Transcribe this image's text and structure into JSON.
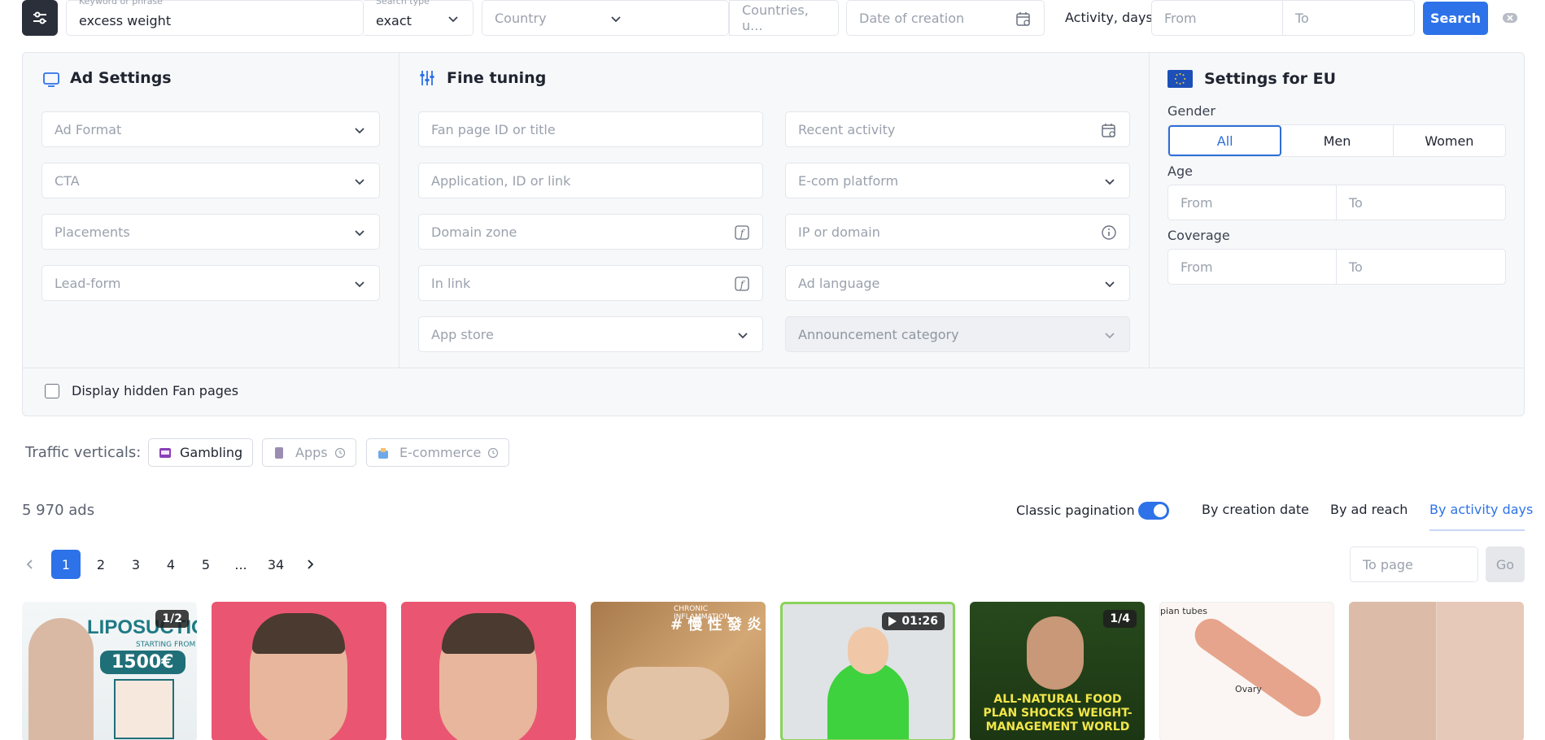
{
  "topbar": {
    "keyword_label": "Keyword or phrase",
    "keyword_value": "excess weight",
    "search_type_label": "Search type",
    "search_type_value": "exact",
    "country_placeholder": "Country",
    "countries_placeholder": "Countries, u...",
    "date_placeholder": "Date of creation",
    "activity_label": "Activity, days",
    "from_placeholder": "From",
    "to_placeholder": "To",
    "search_button": "Search"
  },
  "ad_settings": {
    "title": "Ad Settings",
    "fields": [
      "Ad Format",
      "CTA",
      "Placements",
      "Lead-form"
    ]
  },
  "fine_tuning": {
    "title": "Fine tuning",
    "fan_page": "Fan page ID or title",
    "application": "Application, ID or link",
    "domain_zone": "Domain zone",
    "in_link": "In link",
    "app_store": "App store",
    "recent_activity": "Recent activity",
    "ecom_platform": "E-com platform",
    "ip_domain": "IP or domain",
    "ad_language": "Ad language",
    "announcement_category": "Announcement category"
  },
  "eu_settings": {
    "title": "Settings for EU",
    "gender_label": "Gender",
    "gender_options": [
      "All",
      "Men",
      "Women"
    ],
    "age_label": "Age",
    "coverage_label": "Coverage",
    "from": "From",
    "to": "To"
  },
  "hidden_fanpages_label": "Display hidden Fan pages",
  "traffic": {
    "label": "Traffic verticals:",
    "chips": [
      "Gambling",
      "Apps",
      "E-commerce"
    ]
  },
  "results": {
    "count": "5 970 ads",
    "classic_pagination": "Classic pagination",
    "sort_options": [
      "By creation date",
      "By ad reach",
      "By activity days"
    ],
    "active_sort": "By activity days"
  },
  "pagination": {
    "pages": [
      "1",
      "2",
      "3",
      "4",
      "5",
      "...",
      "34"
    ],
    "to_page_placeholder": "To page",
    "go_button": "Go"
  },
  "thumbnails": [
    {
      "badge": "1/2",
      "text": "LIPOSUCTION",
      "subtext": "STARTING FROM",
      "price": "1500€"
    },
    {
      "badge": "",
      "text": ""
    },
    {
      "badge": "",
      "text": ""
    },
    {
      "badge": "",
      "text": "CHRONIC INFLAMMATION",
      "subtext": "# 慢 性 發 炎"
    },
    {
      "badge": "01:26",
      "text": ""
    },
    {
      "badge": "1/4",
      "text": "ALL-NATURAL FOOD PLAN SHOCKS WEIGHT-MANAGEMENT WORLD"
    },
    {
      "badge": "",
      "text": "pian tubes",
      "subtext": "Ovary"
    },
    {
      "badge": "",
      "text": ""
    }
  ]
}
